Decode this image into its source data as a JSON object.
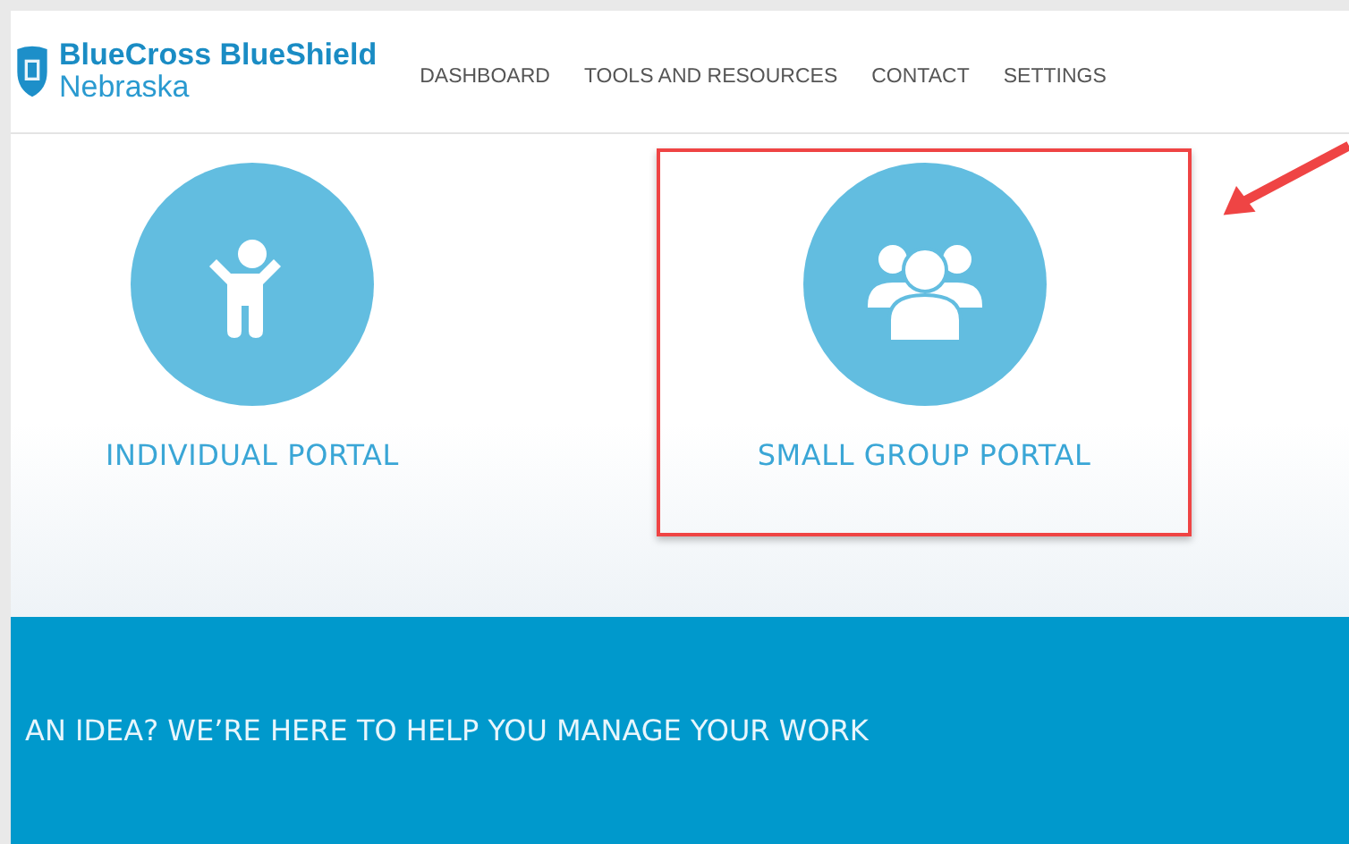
{
  "header": {
    "logo": {
      "name": "BlueCross BlueShield",
      "region": "Nebraska"
    },
    "nav": [
      {
        "label": "DASHBOARD"
      },
      {
        "label": "TOOLS AND RESOURCES"
      },
      {
        "label": "CONTACT"
      },
      {
        "label": "SETTINGS"
      }
    ]
  },
  "portals": [
    {
      "kind": "individual",
      "label": "INDIVIDUAL PORTAL",
      "highlighted": false
    },
    {
      "kind": "group",
      "label": "SMALL GROUP PORTAL",
      "highlighted": true
    }
  ],
  "banner": {
    "text": "AN IDEA? WE’RE HERE TO HELP YOU MANAGE YOUR WORK"
  }
}
